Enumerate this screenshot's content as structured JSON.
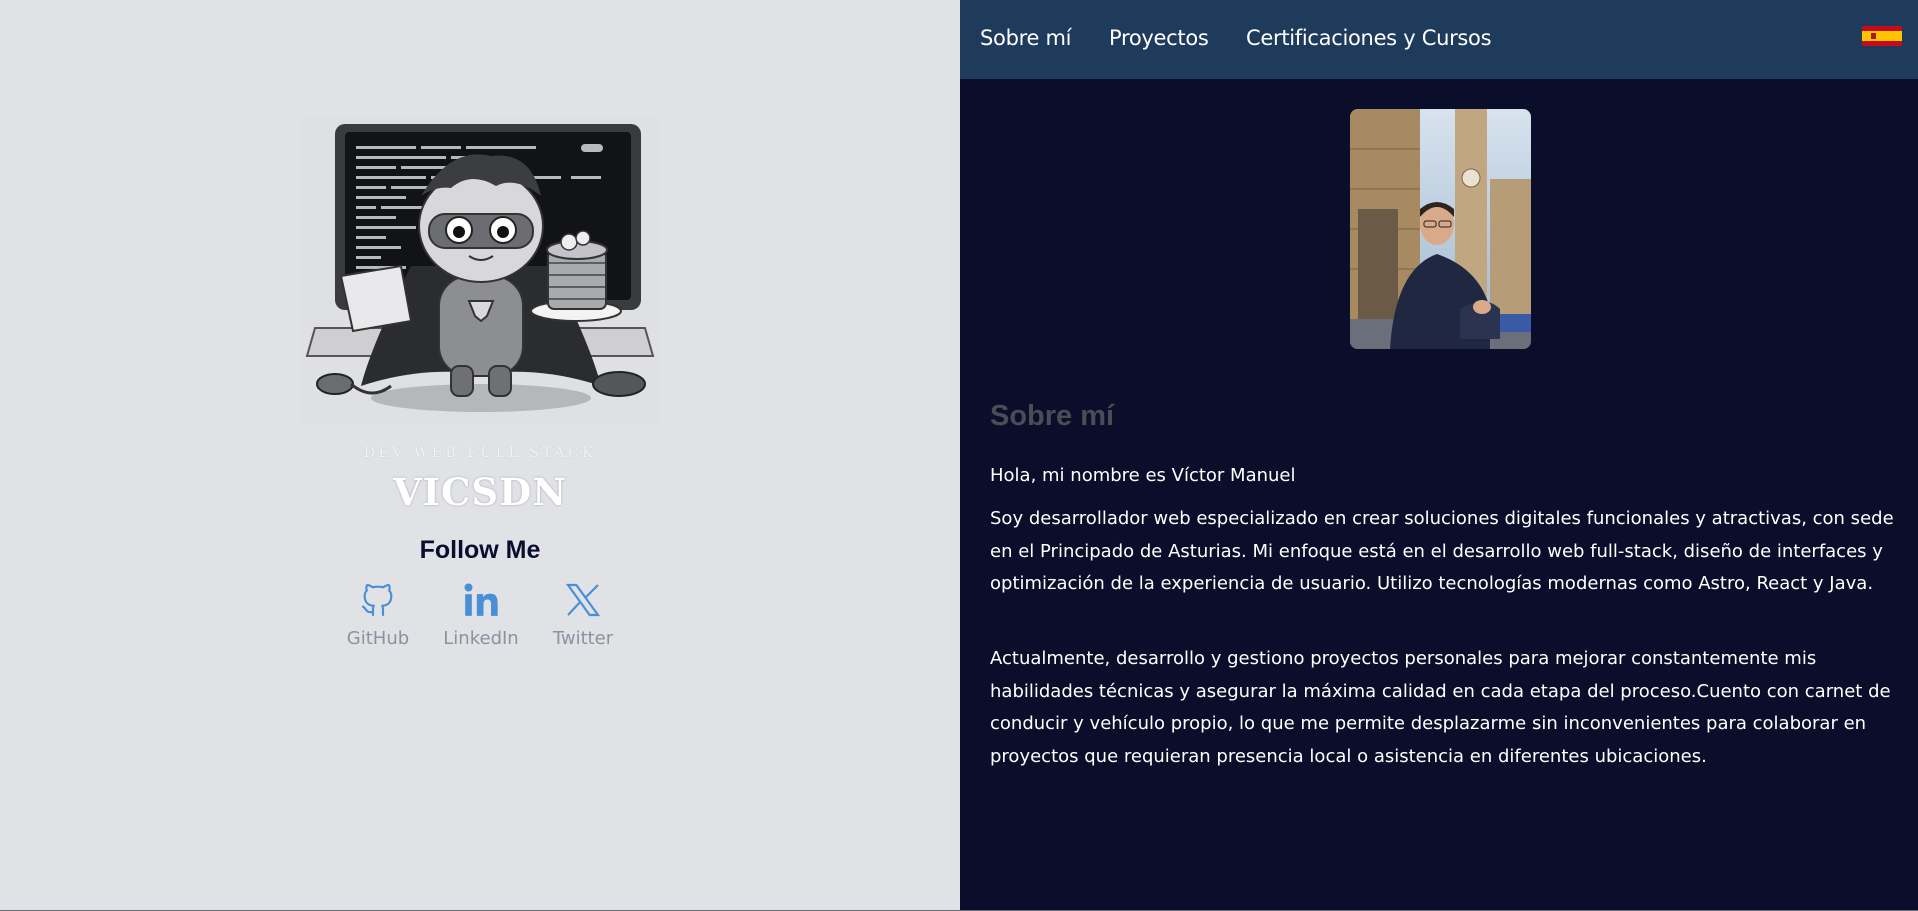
{
  "nav": {
    "items": [
      "Sobre mí",
      "Proyectos",
      "Certificaciones y Cursos"
    ],
    "language_flag_icon": "spain-flag-icon"
  },
  "profile": {
    "tagline": "DEV WEB FULL STACK",
    "brand": "VICSDN",
    "follow_heading": "Follow Me",
    "socials": [
      {
        "label": "GitHub",
        "icon": "github-icon"
      },
      {
        "label": "LinkedIn",
        "icon": "linkedin-icon"
      },
      {
        "label": "Twitter",
        "icon": "x-twitter-icon"
      }
    ]
  },
  "about": {
    "title": "Sobre mí",
    "greeting": "Hola, mi nombre es Víctor Manuel",
    "paragraph_1": "Soy desarrollador web especializado en crear soluciones digitales funcionales y atractivas, con sede en el Principado de Asturias. Mi enfoque está en el desarrollo web full-stack, diseño de interfaces y optimización de la experiencia de usuario. Utilizo tecnologías modernas como Astro, React y Java.",
    "paragraph_2": "Actualmente, desarrollo y gestiono proyectos personales para mejorar constantemente mis habilidades técnicas y asegurar la máxima calidad en cada etapa del proceso.Cuento con carnet de conducir y vehículo propio, lo que me permite desplazarme sin inconvenientes para colaborar en proyectos que requieran presencia local o asistencia en diferentes ubicaciones."
  },
  "colors": {
    "left_bg": "#e1e2e6",
    "right_bg": "#0b0e2a",
    "nav_bg": "#1f3b5c",
    "social_icon": "#4a8fd6",
    "muted_text": "#8d929e"
  }
}
